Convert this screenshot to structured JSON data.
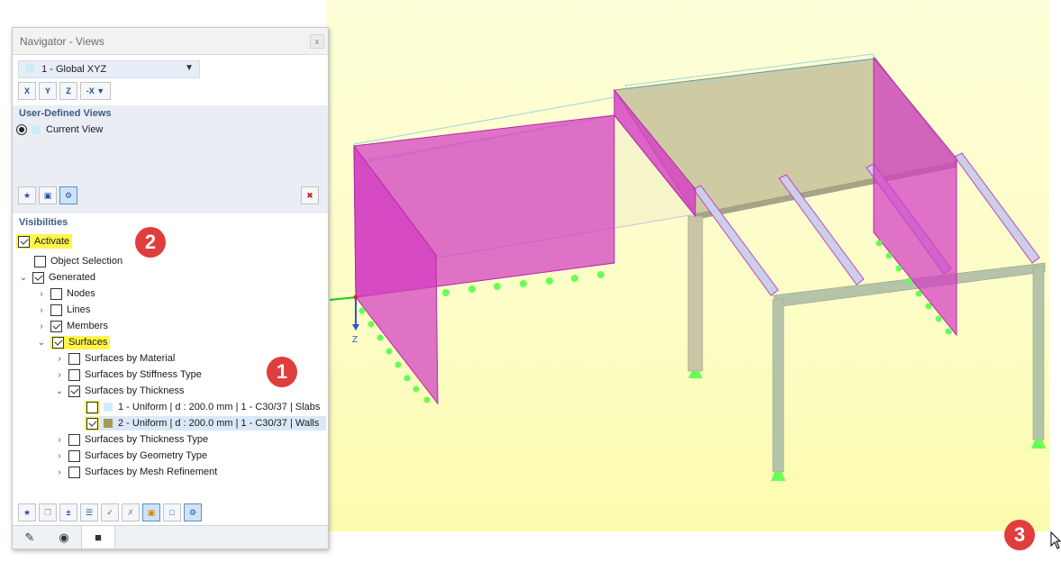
{
  "navigator": {
    "title": "Navigator - Views",
    "close_glyph": "x",
    "view_select": {
      "value": "1 - Global XYZ"
    },
    "view_buttons": [
      {
        "name": "view-x-button",
        "label": "X"
      },
      {
        "name": "view-y-button",
        "label": "Y"
      },
      {
        "name": "view-z-button",
        "label": "Z"
      },
      {
        "name": "view-minus-x-button",
        "label": "-X"
      }
    ],
    "user_views": {
      "heading": "User-Defined Views",
      "current": "Current View"
    },
    "visibilities": {
      "heading": "Visibilities",
      "activate": "Activate",
      "object_selection": "Object Selection",
      "generated": "Generated",
      "nodes": "Nodes",
      "lines": "Lines",
      "members": "Members",
      "surfaces": "Surfaces",
      "by_material": "Surfaces by Material",
      "by_stiffness": "Surfaces by Stiffness Type",
      "by_thickness": "Surfaces by Thickness",
      "thickness_items": [
        {
          "label": "1 - Uniform | d : 200.0 mm | 1 - C30/37 | Slabs",
          "color": "#cdeef8",
          "checked": false
        },
        {
          "label": "2 - Uniform | d : 200.0 mm | 1 - C30/37 | Walls",
          "color": "#a39a55",
          "checked": true
        }
      ],
      "by_thickness_type": "Surfaces by Thickness Type",
      "by_geometry": "Surfaces by Geometry Type",
      "by_mesh": "Surfaces by Mesh Refinement"
    }
  },
  "viewport": {
    "axis_label": "Z",
    "colors": {
      "wall": "#d33bc4",
      "slab": "#b5b598",
      "column": "#b5c3a8",
      "support": "#66ff55"
    }
  },
  "badges": [
    "1",
    "2",
    "3"
  ]
}
